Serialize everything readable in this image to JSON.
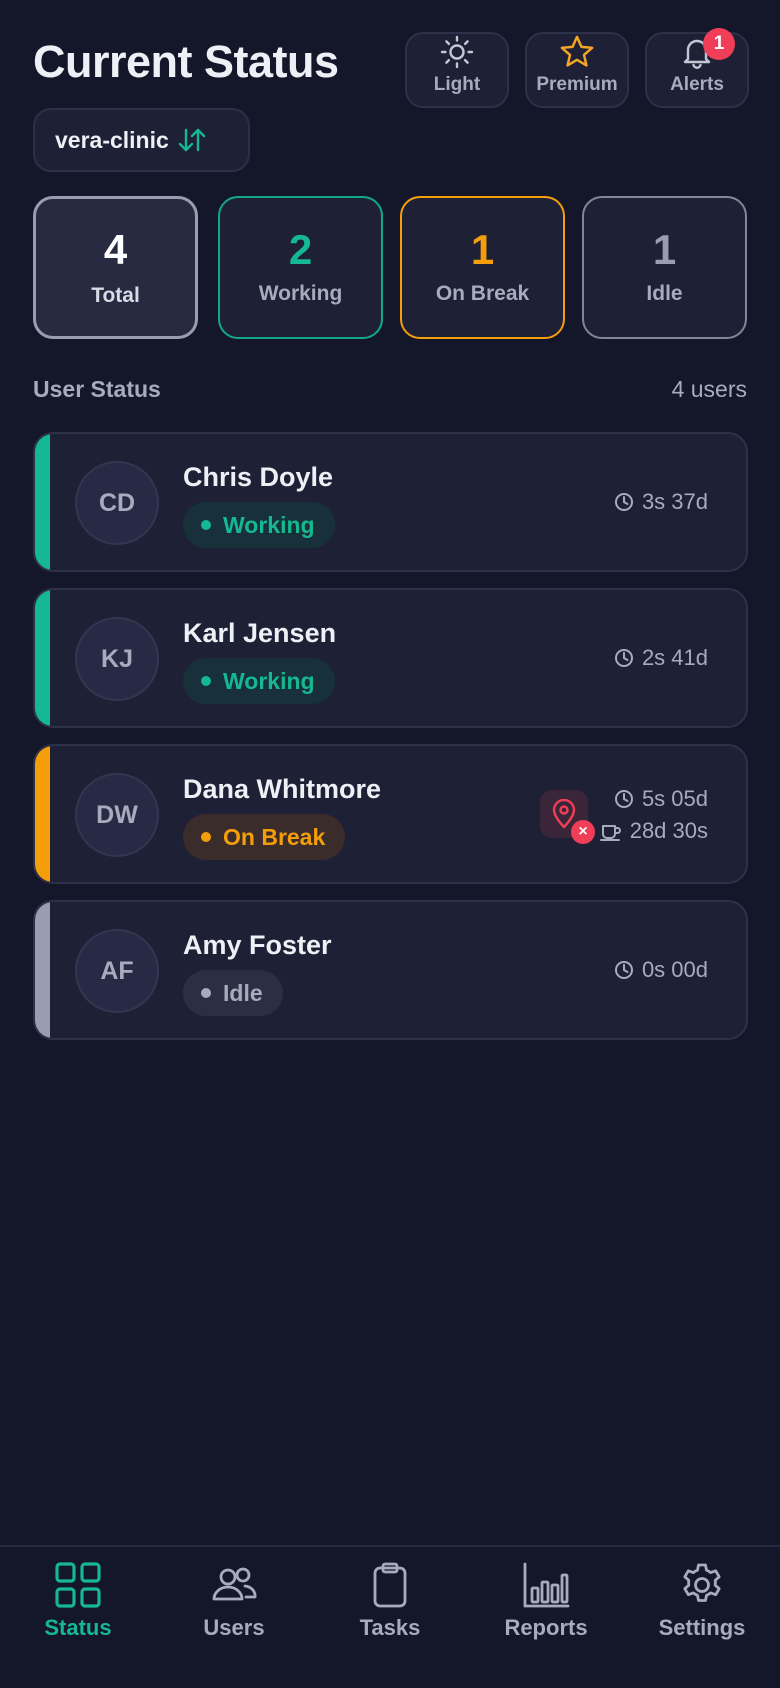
{
  "header": {
    "title": "Current Status"
  },
  "top_buttons": [
    {
      "label": "Light",
      "icon": "sun-icon"
    },
    {
      "label": "Premium",
      "icon": "star-icon"
    },
    {
      "label": "Alerts",
      "icon": "bell-icon",
      "badge": "1"
    }
  ],
  "org": {
    "name": "vera-clinic",
    "icon": "swap-arrows-icon"
  },
  "stats": [
    {
      "value": "4",
      "label": "Total"
    },
    {
      "value": "2",
      "label": "Working",
      "color": "#15b892"
    },
    {
      "value": "1",
      "label": "On Break",
      "color": "#f59e0b"
    },
    {
      "value": "1",
      "label": "Idle",
      "color": "#9a9db1"
    }
  ],
  "section": {
    "title": "User Status",
    "count": "4 users"
  },
  "users": [
    {
      "initials": "CD",
      "name": "Chris Doyle",
      "status": "Working",
      "time": "3s 37d"
    },
    {
      "initials": "KJ",
      "name": "Karl Jensen",
      "status": "Working",
      "time": "2s 41d"
    },
    {
      "initials": "DW",
      "name": "Dana Whitmore",
      "status": "On Break",
      "time": "5s 05d",
      "break_time": "28d 30s",
      "location_icon": "location-off-icon"
    },
    {
      "initials": "AF",
      "name": "Amy Foster",
      "status": "Idle",
      "time": "0s 00d"
    }
  ],
  "nav": [
    {
      "label": "Status",
      "icon": "grid-icon",
      "active": true
    },
    {
      "label": "Users",
      "icon": "users-icon"
    },
    {
      "label": "Tasks",
      "icon": "clipboard-icon"
    },
    {
      "label": "Reports",
      "icon": "bar-chart-icon"
    },
    {
      "label": "Settings",
      "icon": "gear-icon"
    }
  ],
  "colors": {
    "accent": "#15b892",
    "break": "#f59e0b",
    "idle": "#9a9db1",
    "alert": "#f03e58",
    "background": "#14162a"
  }
}
